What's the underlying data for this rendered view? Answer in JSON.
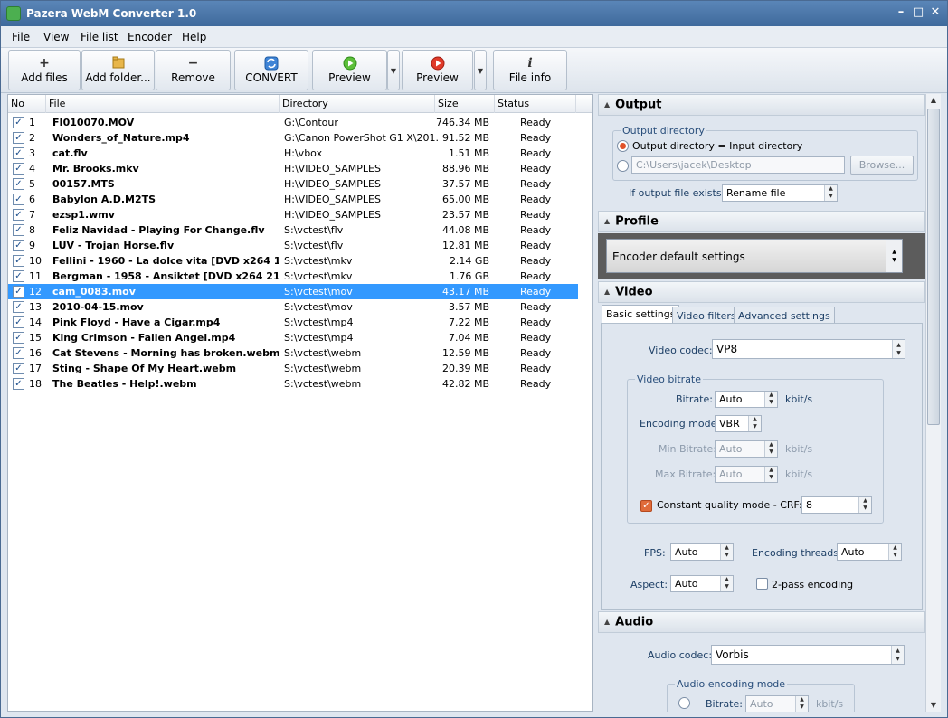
{
  "window": {
    "title": "Pazera WebM Converter 1.0"
  },
  "menu": [
    "File",
    "View",
    "File list",
    "Encoder",
    "Help"
  ],
  "toolbar": {
    "add_files": "Add files",
    "add_folder": "Add folder...",
    "remove": "Remove",
    "convert": "CONVERT",
    "preview1": "Preview",
    "preview2": "Preview",
    "file_info": "File info"
  },
  "list": {
    "columns": {
      "no": "No",
      "file": "File",
      "directory": "Directory",
      "size": "Size",
      "status": "Status"
    },
    "rows": [
      {
        "no": "1",
        "file": "FI010070.MOV",
        "dir": "G:\\Contour",
        "size": "746.34 MB",
        "status": "Ready"
      },
      {
        "no": "2",
        "file": "Wonders_of_Nature.mp4",
        "dir": "G:\\Canon PowerShot G1 X\\201...",
        "size": "91.52 MB",
        "status": "Ready"
      },
      {
        "no": "3",
        "file": "cat.flv",
        "dir": "H:\\vbox",
        "size": "1.51 MB",
        "status": "Ready"
      },
      {
        "no": "4",
        "file": "Mr. Brooks.mkv",
        "dir": "H:\\VIDEO_SAMPLES",
        "size": "88.96 MB",
        "status": "Ready"
      },
      {
        "no": "5",
        "file": "00157.MTS",
        "dir": "H:\\VIDEO_SAMPLES",
        "size": "37.57 MB",
        "status": "Ready"
      },
      {
        "no": "6",
        "file": "Babylon A.D.M2TS",
        "dir": "H:\\VIDEO_SAMPLES",
        "size": "65.00 MB",
        "status": "Ready"
      },
      {
        "no": "7",
        "file": "ezsp1.wmv",
        "dir": "H:\\VIDEO_SAMPLES",
        "size": "23.57 MB",
        "status": "Ready"
      },
      {
        "no": "8",
        "file": "Feliz Navidad - Playing For Change.flv",
        "dir": "S:\\vctest\\flv",
        "size": "44.08 MB",
        "status": "Ready"
      },
      {
        "no": "9",
        "file": "LUV - Trojan Horse.flv",
        "dir": "S:\\vctest\\flv",
        "size": "12.81 MB",
        "status": "Ready"
      },
      {
        "no": "10",
        "file": "Fellini - 1960 - La dolce vita [DVD x264 16...",
        "dir": "S:\\vctest\\mkv",
        "size": "2.14 GB",
        "status": "Ready"
      },
      {
        "no": "11",
        "file": "Bergman - 1958 - Ansiktet [DVD x264 215...",
        "dir": "S:\\vctest\\mkv",
        "size": "1.76 GB",
        "status": "Ready"
      },
      {
        "no": "12",
        "file": "cam_0083.mov",
        "dir": "S:\\vctest\\mov",
        "size": "43.17 MB",
        "status": "Ready"
      },
      {
        "no": "13",
        "file": "2010-04-15.mov",
        "dir": "S:\\vctest\\mov",
        "size": "3.57 MB",
        "status": "Ready"
      },
      {
        "no": "14",
        "file": "Pink Floyd - Have a Cigar.mp4",
        "dir": "S:\\vctest\\mp4",
        "size": "7.22 MB",
        "status": "Ready"
      },
      {
        "no": "15",
        "file": "King Crimson - Fallen Angel.mp4",
        "dir": "S:\\vctest\\mp4",
        "size": "7.04 MB",
        "status": "Ready"
      },
      {
        "no": "16",
        "file": "Cat Stevens - Morning has broken.webm",
        "dir": "S:\\vctest\\webm",
        "size": "12.59 MB",
        "status": "Ready"
      },
      {
        "no": "17",
        "file": "Sting - Shape Of My Heart.webm",
        "dir": "S:\\vctest\\webm",
        "size": "20.39 MB",
        "status": "Ready"
      },
      {
        "no": "18",
        "file": "The Beatles - Help!.webm",
        "dir": "S:\\vctest\\webm",
        "size": "42.82 MB",
        "status": "Ready"
      }
    ],
    "selected_no": "12"
  },
  "output": {
    "section": "Output",
    "group": "Output directory",
    "radio_input": "Output directory = Input directory",
    "path": "C:\\Users\\jacek\\Desktop",
    "browse": "Browse...",
    "exists_label": "If output file exists:",
    "exists_value": "Rename file"
  },
  "profile": {
    "section": "Profile",
    "value": "Encoder default settings"
  },
  "video": {
    "section": "Video",
    "tabs": [
      "Basic settings",
      "Video filters",
      "Advanced settings"
    ],
    "codec_label": "Video codec:",
    "codec_value": "VP8",
    "bitrate_group": "Video bitrate",
    "bitrate_label": "Bitrate:",
    "bitrate_value": "Auto",
    "unit": "kbit/s",
    "mode_label": "Encoding mode:",
    "mode_value": "VBR",
    "min_label": "Min Bitrate:",
    "min_value": "Auto",
    "max_label": "Max Bitrate:",
    "max_value": "Auto",
    "crf_label": "Constant quality mode - CRF:",
    "crf_value": "8",
    "fps_label": "FPS:",
    "fps_value": "Auto",
    "threads_label": "Encoding threads:",
    "threads_value": "Auto",
    "aspect_label": "Aspect:",
    "aspect_value": "Auto",
    "twopass_label": "2-pass encoding"
  },
  "audio": {
    "section": "Audio",
    "codec_label": "Audio codec:",
    "codec_value": "Vorbis",
    "mode_group": "Audio encoding mode",
    "bitrate_label": "Bitrate:",
    "bitrate_value": "Auto",
    "unit": "kbit/s"
  }
}
